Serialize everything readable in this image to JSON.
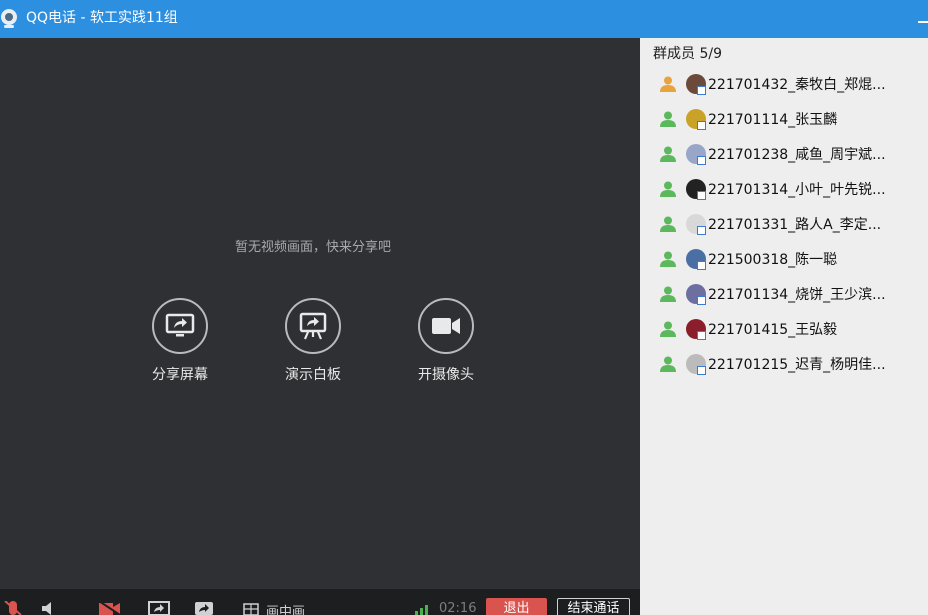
{
  "window": {
    "title": "QQ电话 - 软工实践11组",
    "minimize_icon": "minimize-icon",
    "app_icon": "qq-phone-icon",
    "accent_color": "#2d8fe0"
  },
  "video": {
    "hint": "暂无视频画面，快来分享吧",
    "actions": [
      {
        "label": "分享屏幕",
        "icon": "share-screen-icon"
      },
      {
        "label": "演示白板",
        "icon": "whiteboard-icon"
      },
      {
        "label": "开摄像头",
        "icon": "camera-icon"
      }
    ]
  },
  "toolbar": {
    "pip_label": "画中画",
    "call_time": "02:16",
    "exit_label": "退出",
    "end_call_label": "结束通话",
    "exit_color": "#d9534f"
  },
  "members": {
    "header": "群成员 5/9",
    "list": [
      {
        "name": "221701432_秦牧白_郑焜...",
        "icon_color": "#e8a33c",
        "avatar_color": "#6b4a3a"
      },
      {
        "name": "221701114_张玉麟",
        "icon_color": "#5cb85c",
        "avatar_color": "#c9a227"
      },
      {
        "name": "221701238_咸鱼_周宇斌...",
        "icon_color": "#5cb85c",
        "avatar_color": "#9aa6c8"
      },
      {
        "name": "221701314_小叶_叶先锐...",
        "icon_color": "#5cb85c",
        "avatar_color": "#222222"
      },
      {
        "name": "221701331_路人A_李定...",
        "icon_color": "#5cb85c",
        "avatar_color": "#d8d8d8"
      },
      {
        "name": "221500318_陈一聪",
        "icon_color": "#5cb85c",
        "avatar_color": "#4a6fa5"
      },
      {
        "name": "221701134_烧饼_王少滨...",
        "icon_color": "#5cb85c",
        "avatar_color": "#6d6fa0"
      },
      {
        "name": "221701415_王弘毅",
        "icon_color": "#5cb85c",
        "avatar_color": "#8b1e2b"
      },
      {
        "name": "221701215_迟青_杨明佳...",
        "icon_color": "#5cb85c",
        "avatar_color": "#bbbbbb"
      }
    ]
  }
}
